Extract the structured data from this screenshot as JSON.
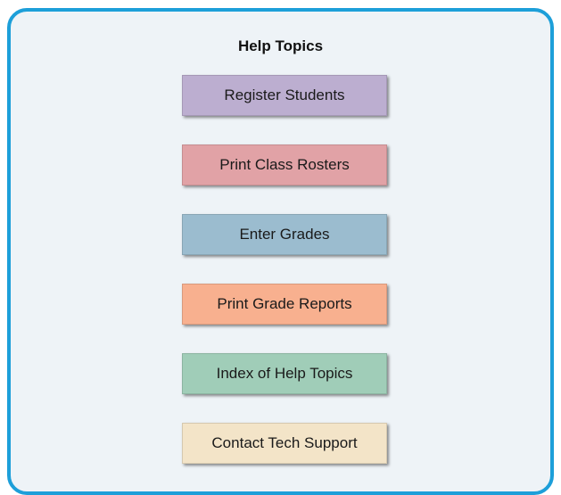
{
  "title": "Help Topics",
  "topics": [
    {
      "label": "Register Students",
      "color": "#bcaed0"
    },
    {
      "label": "Print Class Rosters",
      "color": "#e1a2a6"
    },
    {
      "label": "Enter Grades",
      "color": "#9bbccf"
    },
    {
      "label": "Print Grade Reports",
      "color": "#f8b08f"
    },
    {
      "label": "Index of Help Topics",
      "color": "#a0cdb8"
    },
    {
      "label": "Contact Tech Support",
      "color": "#f3e4c8"
    }
  ],
  "colors": {
    "border": "#1d9fd9",
    "panel_background": "#eef3f7"
  }
}
